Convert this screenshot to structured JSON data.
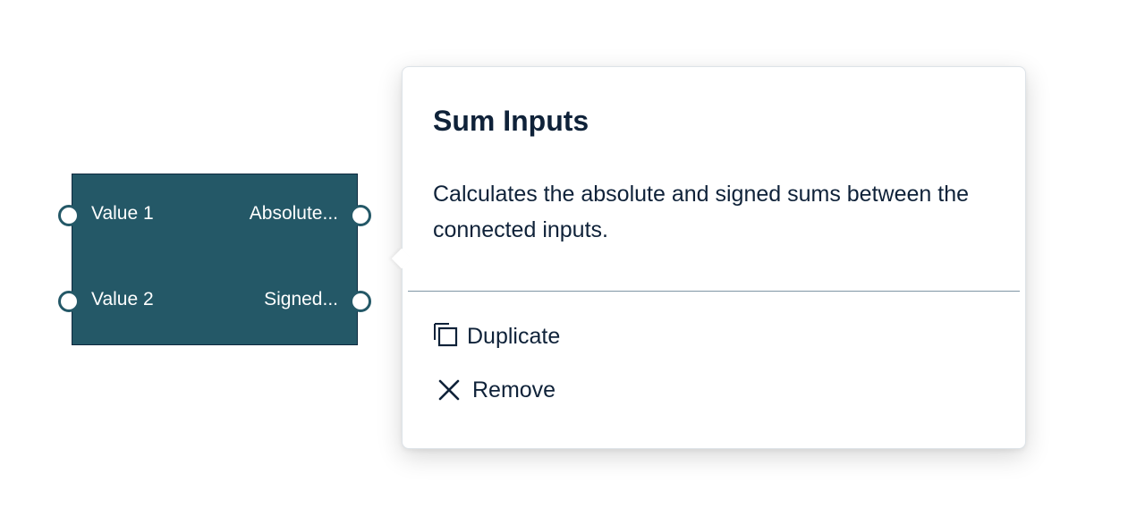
{
  "node": {
    "inputs": [
      {
        "label": "Value 1"
      },
      {
        "label": "Value 2"
      }
    ],
    "outputs": [
      {
        "label": "Absolute..."
      },
      {
        "label": "Signed..."
      }
    ],
    "colors": {
      "fill": "#245867",
      "border": "#0f2a3f",
      "port": "#ffffff"
    }
  },
  "popover": {
    "title": "Sum Inputs",
    "description": "Calculates the absolute and signed sums between the connected inputs.",
    "actions": [
      {
        "label": "Duplicate",
        "icon": "duplicate-icon"
      },
      {
        "label": "Remove",
        "icon": "close-icon"
      }
    ],
    "colors": {
      "text": "#0f2239",
      "divider": "#7f95a5"
    }
  }
}
